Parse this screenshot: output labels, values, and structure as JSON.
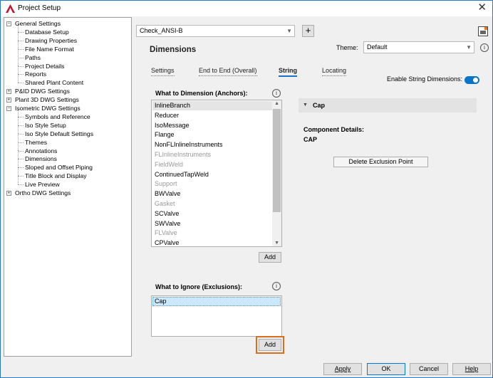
{
  "window": {
    "title": "Project Setup",
    "close_glyph": "✕"
  },
  "tree": {
    "items": [
      {
        "label": "General Settings",
        "level": 0,
        "expander": "−"
      },
      {
        "label": "Database Setup",
        "level": 1
      },
      {
        "label": "Drawing Properties",
        "level": 1
      },
      {
        "label": "File Name Format",
        "level": 1
      },
      {
        "label": "Paths",
        "level": 1
      },
      {
        "label": "Project Details",
        "level": 1
      },
      {
        "label": "Reports",
        "level": 1
      },
      {
        "label": "Shared Plant Content",
        "level": 1
      },
      {
        "label": "P&ID DWG Settings",
        "level": 0,
        "expander": "+"
      },
      {
        "label": "Plant 3D DWG Settings",
        "level": 0,
        "expander": "+"
      },
      {
        "label": "Isometric DWG Settings",
        "level": 0,
        "expander": "−"
      },
      {
        "label": "Symbols and Reference",
        "level": 1
      },
      {
        "label": "Iso Style Setup",
        "level": 1
      },
      {
        "label": "Iso Style Default Settings",
        "level": 1
      },
      {
        "label": "Themes",
        "level": 1
      },
      {
        "label": "Annotations",
        "level": 1
      },
      {
        "label": "Dimensions",
        "level": 1
      },
      {
        "label": "Sloped and Offset Piping",
        "level": 1
      },
      {
        "label": "Title Block and Display",
        "level": 1
      },
      {
        "label": "Live Preview",
        "level": 1
      },
      {
        "label": "Ortho DWG Settings",
        "level": 0,
        "expander": "+"
      }
    ]
  },
  "style_combo": {
    "value": "Check_ANSI-B",
    "add_glyph": "+"
  },
  "page_title": "Dimensions",
  "theme": {
    "label": "Theme:",
    "value": "Default",
    "info_glyph": "i"
  },
  "tabs": [
    "Settings",
    "End to End (Overall)",
    "String",
    "Locating"
  ],
  "enable_string": {
    "label": "Enable String Dimensions:",
    "on": true
  },
  "anchors": {
    "title": "What to Dimension (Anchors):",
    "info_glyph": "i",
    "items": [
      {
        "label": "InlineBranch",
        "enabled": true,
        "selected": true
      },
      {
        "label": "Reducer",
        "enabled": true
      },
      {
        "label": "IsoMessage",
        "enabled": true
      },
      {
        "label": "Flange",
        "enabled": true
      },
      {
        "label": "NonFLInlineInstruments",
        "enabled": true
      },
      {
        "label": "FLInlineInstruments",
        "enabled": false
      },
      {
        "label": "FieldWeld",
        "enabled": false
      },
      {
        "label": "ContinuedTapWeld",
        "enabled": true
      },
      {
        "label": "Support",
        "enabled": false
      },
      {
        "label": "BWValve",
        "enabled": true
      },
      {
        "label": "Gasket",
        "enabled": false
      },
      {
        "label": "SCValve",
        "enabled": true
      },
      {
        "label": "SWValve",
        "enabled": true
      },
      {
        "label": "FLValve",
        "enabled": false
      },
      {
        "label": "CPValve",
        "enabled": true
      }
    ],
    "add_label": "Add"
  },
  "exclusions": {
    "title": "What to Ignore (Exclusions):",
    "info_glyph": "i",
    "items": [
      "Cap"
    ],
    "add_label": "Add"
  },
  "detail": {
    "header": "Cap",
    "component_label": "Component Details:",
    "component_value": "CAP",
    "delete_button": "Delete Exclusion Point"
  },
  "footer": {
    "apply": "Apply",
    "ok": "OK",
    "cancel": "Cancel",
    "help": "Help"
  },
  "colors": {
    "accent": "#0a74c8",
    "highlight_border": "#d86e1e",
    "selection": "#cce8ff"
  }
}
